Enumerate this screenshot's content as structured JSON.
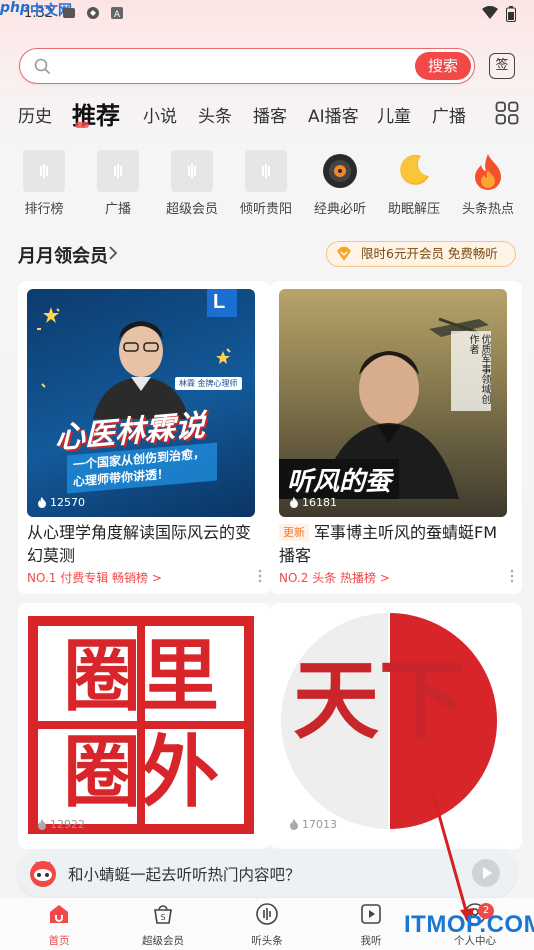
{
  "status_bar": {
    "time": "1:32",
    "watermark_php": "php",
    "watermark_cn": "中文网"
  },
  "search": {
    "placeholder": "",
    "button_label": "搜索",
    "sign_label": "签"
  },
  "tabs": [
    {
      "label": "历史"
    },
    {
      "label": "推荐"
    },
    {
      "label": "小说"
    },
    {
      "label": "头条"
    },
    {
      "label": "播客"
    },
    {
      "label": "AI播客"
    },
    {
      "label": "儿童"
    },
    {
      "label": "广播"
    }
  ],
  "quick_links": [
    {
      "label": "排行榜",
      "icon": "ranking-icon"
    },
    {
      "label": "广播",
      "icon": "radio-icon"
    },
    {
      "label": "超级会员",
      "icon": "vip-icon"
    },
    {
      "label": "倾听贵阳",
      "icon": "city-audio-icon"
    },
    {
      "label": "经典必听",
      "icon": "vinyl-record-icon"
    },
    {
      "label": "助眠解压",
      "icon": "moon-icon"
    },
    {
      "label": "头条热点",
      "icon": "flame-icon"
    }
  ],
  "section": {
    "title": "月月领会员",
    "promo": "限时6元开会员 免费畅听"
  },
  "cards": [
    {
      "cover_title": "心医林霖说",
      "cover_subtitle": "一个国家从创伤到治愈，心理师带你讲透！",
      "cover_tag": "林霖 金牌心理师",
      "cover_badge": "L",
      "play_count": "12570",
      "tag": "",
      "title": "从心理学角度解读国际风云的变幻莫测",
      "rank": "NO.1 付费专辑 畅销榜 >"
    },
    {
      "cover_title": "听风的蚕",
      "cover_subtitle": "优质军事领域创作者",
      "cover_tag": "",
      "cover_badge": "",
      "play_count": "16181",
      "tag": "更新",
      "title": "军事博主听风的蚕蜻蜓FM播客",
      "rank": "NO.2 头条 热播榜 >"
    },
    {
      "cover_title": "圈里圈外",
      "play_count": "12922"
    },
    {
      "cover_title": "天下",
      "play_count": "17013"
    }
  ],
  "banner": {
    "text": "和小蜻蜓一起去听听热门内容吧？"
  },
  "bottom_nav": [
    {
      "label": "首页",
      "icon": "home-icon",
      "active": true
    },
    {
      "label": "超级会员",
      "icon": "vip-bag-icon"
    },
    {
      "label": "听头条",
      "icon": "news-audio-icon"
    },
    {
      "label": "我听",
      "icon": "my-listen-icon"
    },
    {
      "label": "个人中心",
      "icon": "profile-icon",
      "badge": "2"
    }
  ],
  "watermark": "ITMOP.COM",
  "colors": {
    "accent": "#f24848",
    "promo_text": "#7a4a10",
    "watermark": "#1976d2"
  }
}
